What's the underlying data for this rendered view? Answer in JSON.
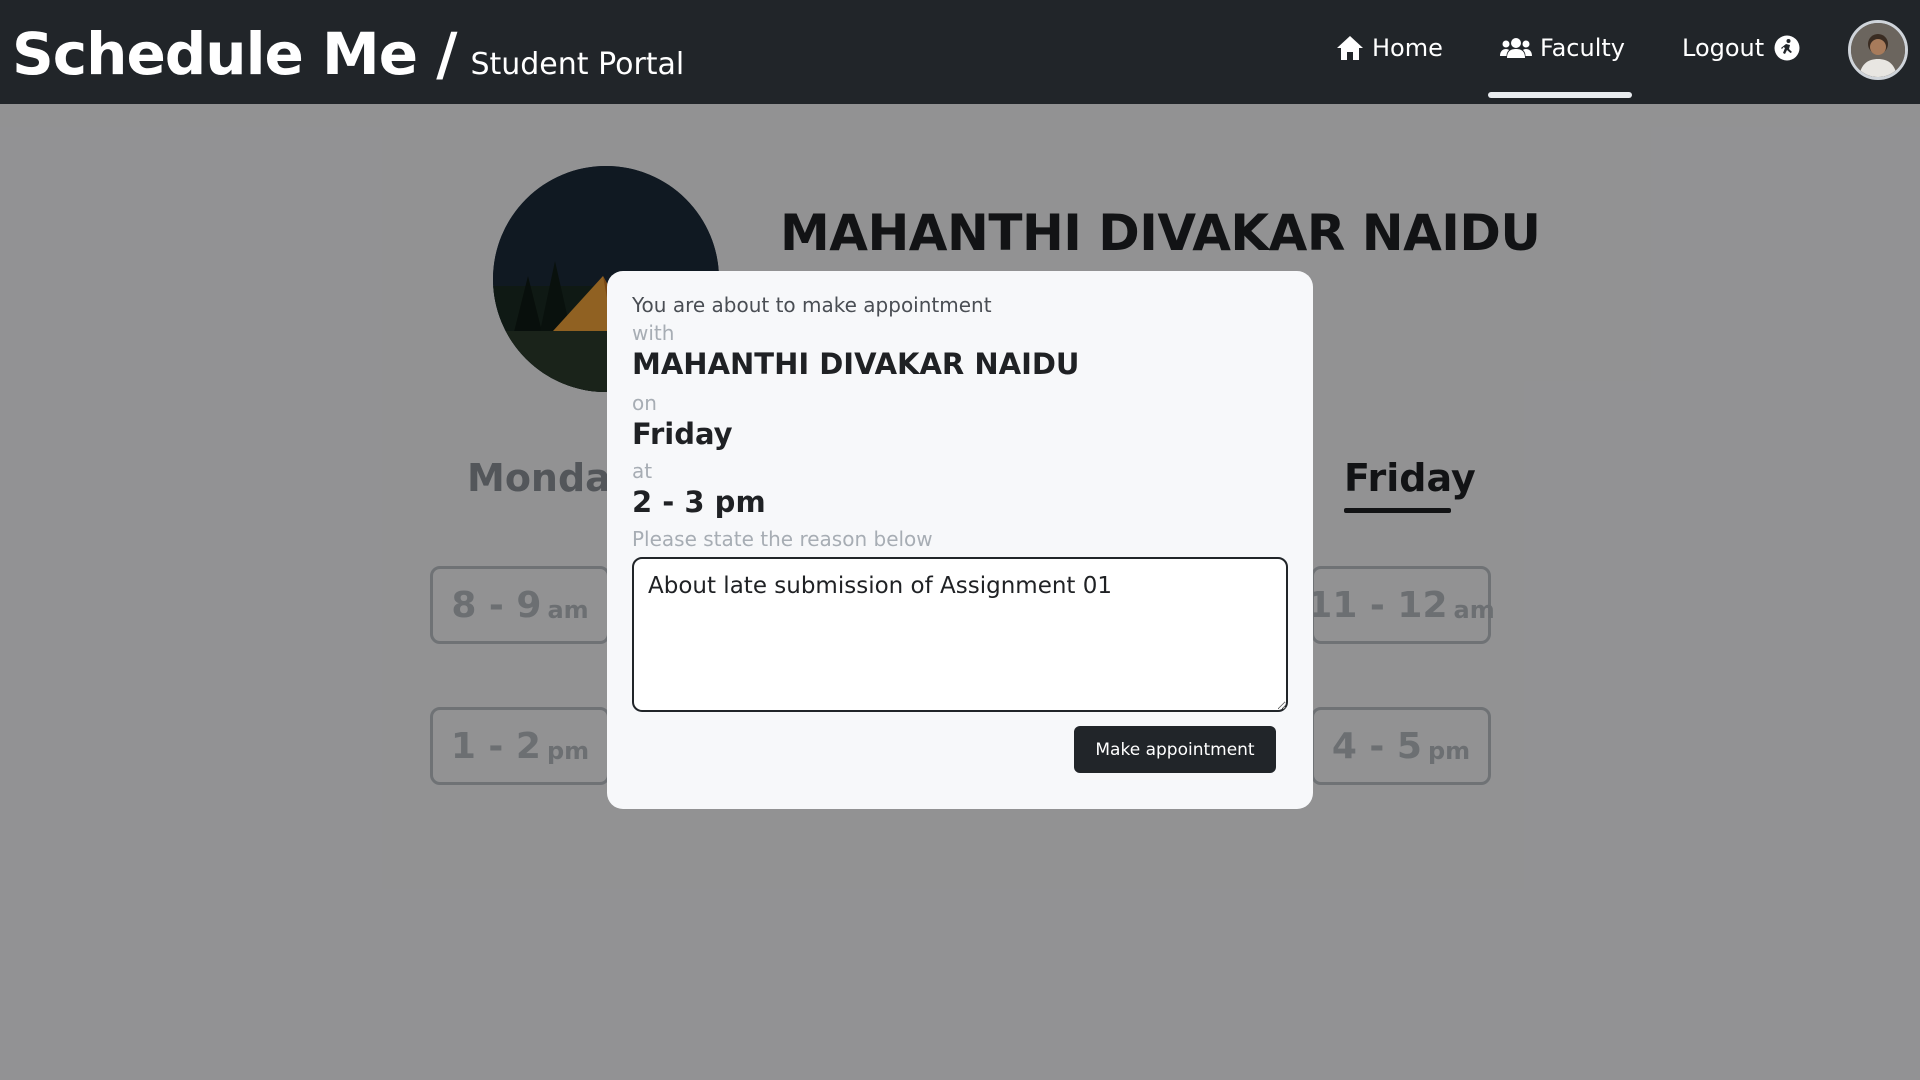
{
  "navbar": {
    "brand_title": "Schedule Me /",
    "brand_subtitle": "Student Portal",
    "items": [
      {
        "label": "Home",
        "icon": "home-icon"
      },
      {
        "label": "Faculty",
        "icon": "users-icon",
        "active": true
      },
      {
        "label": "Logout",
        "icon": "run-icon"
      }
    ]
  },
  "profile": {
    "faculty_name": "MAHANTHI DIVAKAR NAIDU"
  },
  "days": {
    "visible": [
      "Monday",
      "Friday"
    ],
    "selected": "Friday"
  },
  "slots": [
    {
      "time": "8 - 9",
      "suffix": "am"
    },
    {
      "time": "11 - 12",
      "suffix": "am"
    },
    {
      "time": "1 - 2",
      "suffix": "pm"
    },
    {
      "time": "4 - 5",
      "suffix": "pm"
    }
  ],
  "modal": {
    "intro": "You are about to make appointment",
    "with_label": "with",
    "faculty_name": "MAHANTHI DIVAKAR NAIDU",
    "on_label": "on",
    "day": "Friday",
    "at_label": "at",
    "time": "2 - 3 pm",
    "reason_label": "Please state the reason below",
    "reason_value": "About late submission of Assignment 01",
    "button_label": "Make appointment"
  },
  "colors": {
    "navbar_bg": "#212529",
    "modal_bg": "#f7f8fa",
    "button_bg": "#212529",
    "overlay": "rgba(0,0,0,0.4)"
  }
}
